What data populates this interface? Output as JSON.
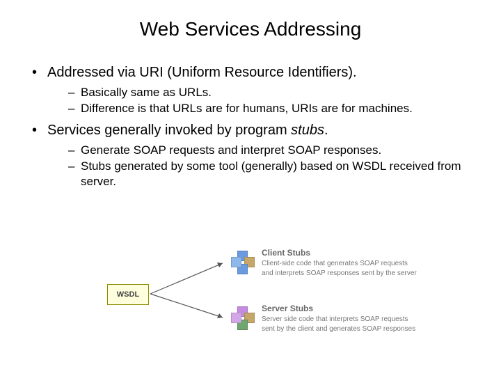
{
  "title": "Web Services Addressing",
  "bullets": {
    "b1": "Addressed via URI (Uniform Resource Identifiers).",
    "b1a": "Basically same as URLs.",
    "b1b": "Difference is that URLs are for humans, URIs are for machines.",
    "b2_head": "Services generally invoked by program ",
    "b2_emph": "stubs",
    "b2_tail": ".",
    "b2a": "Generate SOAP requests and interpret SOAP responses.",
    "b2b": "Stubs generated by some tool (generally) based on WSDL received from server."
  },
  "diagram": {
    "wsdl": "WSDL",
    "client_title": "Client Stubs",
    "client_desc": "Client-side code that generates SOAP requests and interprets SOAP responses sent by the server",
    "server_title": "Server Stubs",
    "server_desc": "Server side code that interprets SOAP requests sent by the client and generates SOAP responses"
  }
}
